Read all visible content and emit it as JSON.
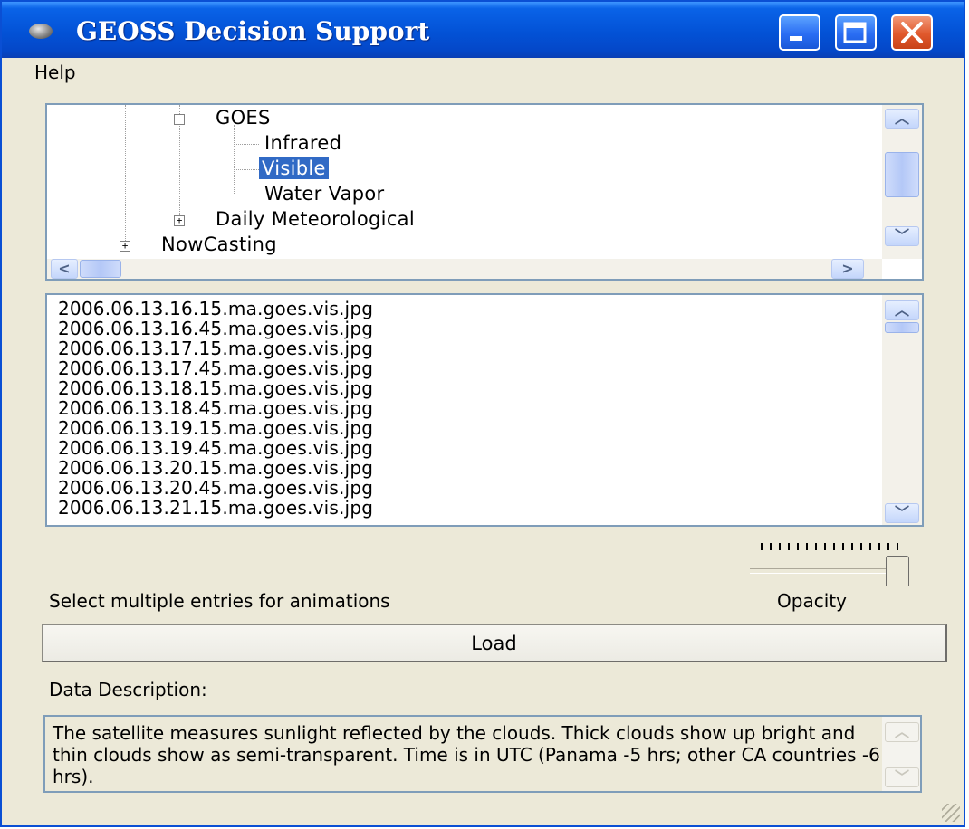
{
  "window": {
    "title": "GEOSS Decision Support",
    "buttons": {
      "minimize": "_",
      "maximize": "□",
      "close": "✕"
    }
  },
  "menubar": {
    "items": [
      "Help"
    ]
  },
  "tree": {
    "nodes": [
      {
        "label": "GOES",
        "expander": "−"
      },
      {
        "label": "Infrared"
      },
      {
        "label": "Visible",
        "selected": true
      },
      {
        "label": "Water Vapor"
      },
      {
        "label": "Daily Meteorological",
        "expander": "+"
      },
      {
        "label": "NowCasting",
        "expander": "+"
      }
    ]
  },
  "file_list": {
    "items": [
      "2006.06.13.16.15.ma.goes.vis.jpg",
      "2006.06.13.16.45.ma.goes.vis.jpg",
      "2006.06.13.17.15.ma.goes.vis.jpg",
      "2006.06.13.17.45.ma.goes.vis.jpg",
      "2006.06.13.18.15.ma.goes.vis.jpg",
      "2006.06.13.18.45.ma.goes.vis.jpg",
      "2006.06.13.19.15.ma.goes.vis.jpg",
      "2006.06.13.19.45.ma.goes.vis.jpg",
      "2006.06.13.20.15.ma.goes.vis.jpg",
      "2006.06.13.20.45.ma.goes.vis.jpg",
      "2006.06.13.21.15.ma.goes.vis.jpg"
    ]
  },
  "hint_text": "Select multiple entries for animations",
  "opacity": {
    "label": "Opacity",
    "value": 1.0
  },
  "load_button": "Load",
  "description": {
    "label": "Data Description:",
    "text": "The satellite measures sunlight reflected by the clouds. Thick clouds show up bright and thin clouds show as semi-transparent. Time is in UTC (Panama -5 hrs; other CA countries -6 hrs)."
  },
  "scroll_glyphs": {
    "up": "︿",
    "down": "﹀",
    "left": "<",
    "right": ">"
  },
  "colors": {
    "titlebar": "#0352d6",
    "selection": "#316ac5",
    "window_bg": "#ece9d8"
  },
  "icons": [
    "app-icon",
    "minimize-icon",
    "maximize-icon",
    "close-icon",
    "expand-icon",
    "collapse-icon"
  ]
}
